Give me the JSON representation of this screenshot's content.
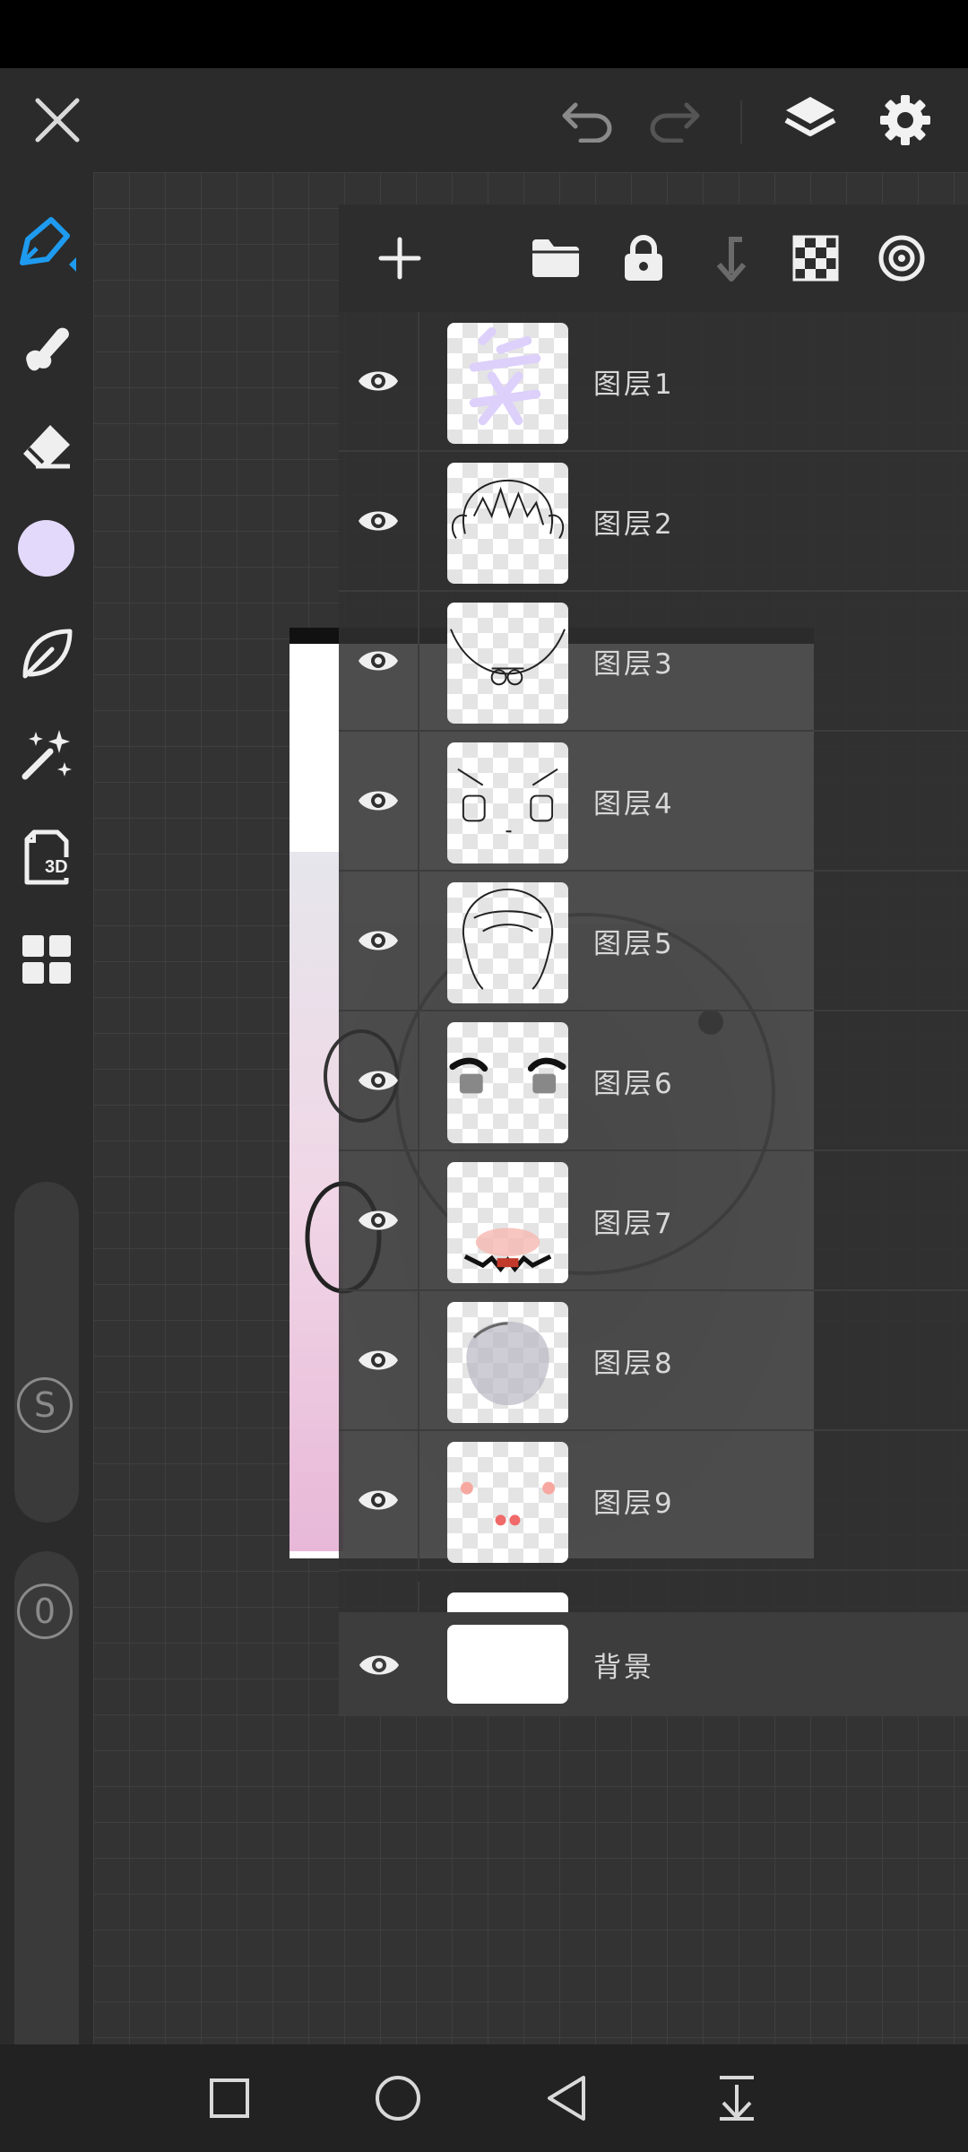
{
  "layers_panel": {
    "layers": [
      {
        "name": "图层1",
        "visible": true
      },
      {
        "name": "图层2",
        "visible": true
      },
      {
        "name": "图层3",
        "visible": true
      },
      {
        "name": "图层4",
        "visible": true
      },
      {
        "name": "图层5",
        "visible": true
      },
      {
        "name": "图层6",
        "visible": true
      },
      {
        "name": "图层7",
        "visible": true
      },
      {
        "name": "图层8",
        "visible": true
      },
      {
        "name": "图层9",
        "visible": true
      }
    ],
    "background_layer": {
      "name": "背景",
      "visible": true
    }
  },
  "left_toolbar": {
    "current_color": "#e3d9fb",
    "size_slider_label": "S",
    "opacity_slider_label": "0"
  },
  "icons": {
    "close": "close-icon",
    "undo": "undo-icon",
    "redo": "redo-icon",
    "layers": "layers-icon",
    "settings": "gear-icon",
    "pen": "pen-icon",
    "smudge": "smudge-icon",
    "eraser": "eraser-icon",
    "leaf": "leaf-icon",
    "magic": "magic-wand-icon",
    "3d": "3d-icon",
    "grid": "grid-icon",
    "add_layer": "plus-icon",
    "folder": "folder-icon",
    "lock": "lock-icon",
    "merge_down": "merge-down-icon",
    "checker": "transparency-icon",
    "blend": "blend-mode-icon",
    "eye": "eye-icon"
  },
  "colors": {
    "accent": "#1e9bf0",
    "background": "#2b2b2b"
  },
  "tool_3d_label": "3D"
}
